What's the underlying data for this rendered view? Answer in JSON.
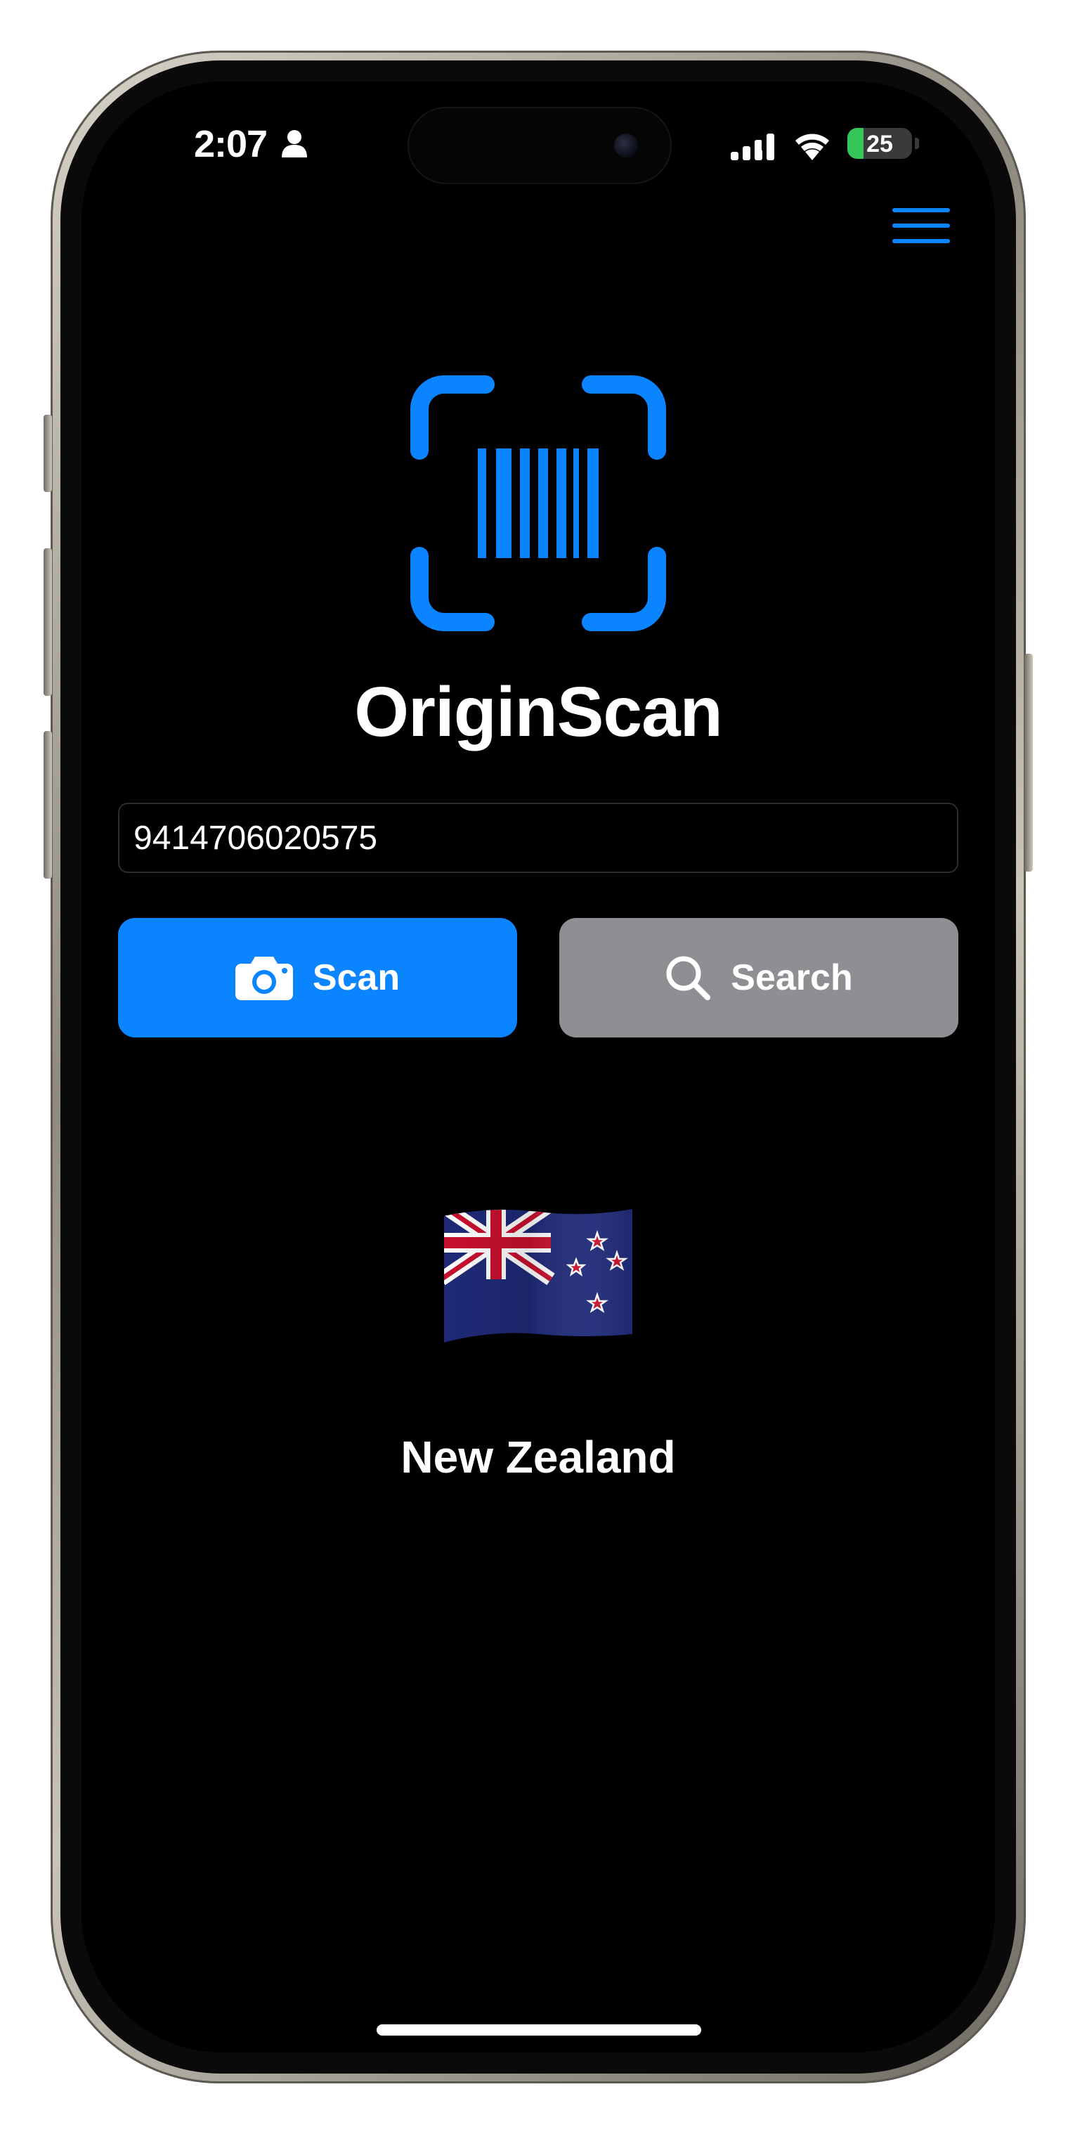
{
  "status_bar": {
    "time": "2:07",
    "battery_level": "25",
    "battery_fraction": 0.25
  },
  "header": {
    "menu_icon": "hamburger-menu-icon"
  },
  "app": {
    "title": "OriginScan",
    "logo_icon": "barcode-viewfinder-icon",
    "accent_color": "#0a84ff"
  },
  "barcode_input": {
    "value": "9414706020575"
  },
  "actions": {
    "scan_label": "Scan",
    "scan_icon": "camera-icon",
    "search_label": "Search",
    "search_icon": "magnifying-glass-icon"
  },
  "result": {
    "flag_icon": "new-zealand-flag-icon",
    "country": "New Zealand"
  }
}
